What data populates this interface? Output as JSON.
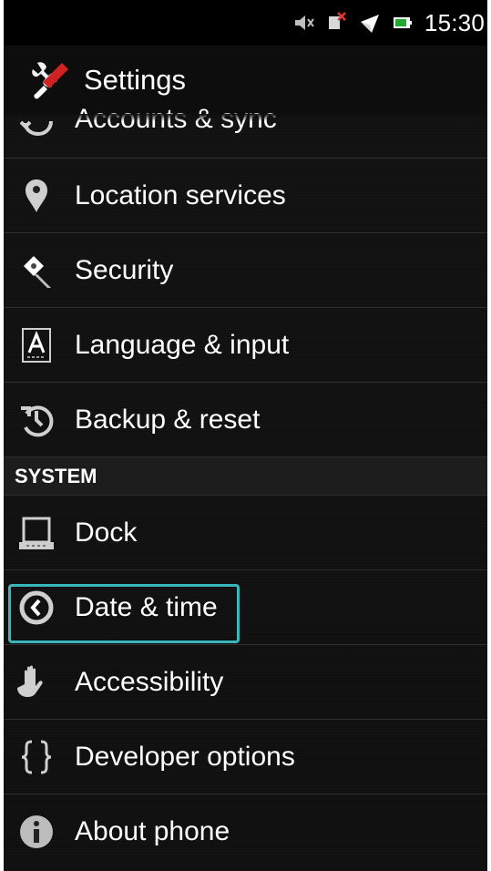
{
  "status_bar": {
    "time": "15:30",
    "icons": [
      "mute-icon",
      "signal-off-icon",
      "airplane-icon",
      "battery-icon"
    ]
  },
  "header": {
    "title": "Settings",
    "icon": "settings-tools-icon"
  },
  "list": {
    "items_top": [
      {
        "label": "Accounts & sync",
        "icon": "sync-icon"
      },
      {
        "label": "Location services",
        "icon": "location-icon"
      },
      {
        "label": "Security",
        "icon": "lock-key-icon"
      },
      {
        "label": "Language & input",
        "icon": "language-icon"
      },
      {
        "label": "Backup & reset",
        "icon": "backup-icon"
      }
    ],
    "section_label": "SYSTEM",
    "items_system": [
      {
        "label": "Dock",
        "icon": "dock-icon"
      },
      {
        "label": "Date & time",
        "icon": "clock-icon"
      },
      {
        "label": "Accessibility",
        "icon": "hand-icon"
      },
      {
        "label": "Developer options",
        "icon": "braces-icon"
      },
      {
        "label": "About phone",
        "icon": "info-icon"
      }
    ]
  },
  "colors": {
    "background": "#111111",
    "divider": "#2f2f2f",
    "section_background": "#1d1d1d",
    "highlight": "#39b8bc",
    "text": "#ffffff",
    "icon": "#d8d8d8"
  }
}
